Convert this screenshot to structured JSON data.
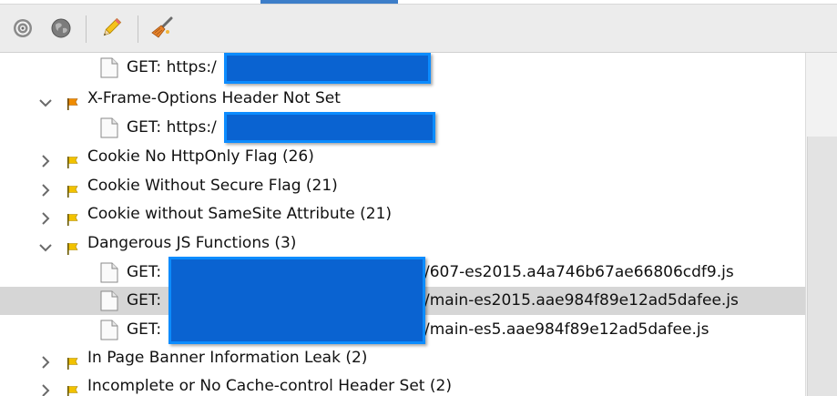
{
  "toolbar": {
    "buttons": [
      {
        "name": "target-icon"
      },
      {
        "name": "globe-icon"
      },
      {
        "name": "pencil-icon"
      },
      {
        "name": "broom-icon"
      }
    ]
  },
  "tree": {
    "rows": [
      {
        "kind": "leaf",
        "label": "GET: https:/",
        "redacted": true
      },
      {
        "kind": "alert",
        "expanded": true,
        "flag": "orange",
        "label": "X-Frame-Options Header Not Set"
      },
      {
        "kind": "leaf",
        "label": "GET: https:/",
        "redacted": true
      },
      {
        "kind": "alert",
        "expanded": false,
        "flag": "yellow",
        "label": "Cookie No HttpOnly Flag (26)"
      },
      {
        "kind": "alert",
        "expanded": false,
        "flag": "yellow",
        "label": "Cookie Without Secure Flag (21)"
      },
      {
        "kind": "alert",
        "expanded": false,
        "flag": "yellow",
        "label": "Cookie without SameSite Attribute (21)"
      },
      {
        "kind": "alert",
        "expanded": true,
        "flag": "yellow",
        "label": "Dangerous JS Functions (3)"
      },
      {
        "kind": "leaf",
        "label": "GET:",
        "suffix": "/607-es2015.a4a746b67ae66806cdf9.js",
        "redacted": true
      },
      {
        "kind": "leaf",
        "label": "GET:",
        "suffix": "/main-es2015.aae984f89e12ad5dafee.js",
        "redacted": true,
        "selected": true
      },
      {
        "kind": "leaf",
        "label": "GET:",
        "suffix": "/main-es5.aae984f89e12ad5dafee.js",
        "redacted": true
      },
      {
        "kind": "alert",
        "expanded": false,
        "flag": "yellow",
        "label": "In Page Banner Information Leak (2)"
      },
      {
        "kind": "alert",
        "expanded": false,
        "flag": "yellow",
        "label": "Incomplete or No Cache-control Header Set (2)"
      }
    ]
  },
  "colors": {
    "flag_orange": "#f08c00",
    "flag_yellow": "#f2c200",
    "redaction": "#0a63d1",
    "selection": "#d6d6d6"
  }
}
